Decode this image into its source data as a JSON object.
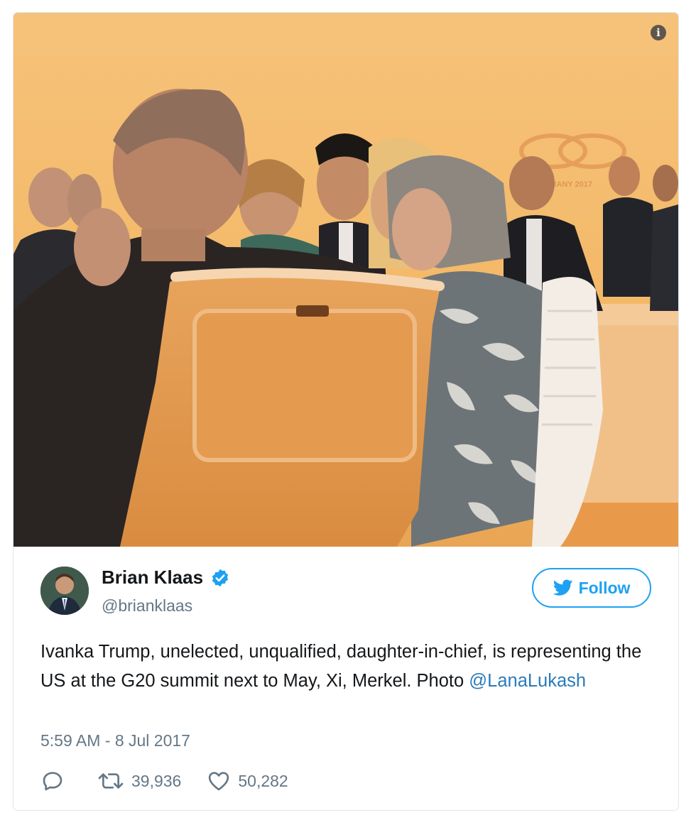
{
  "tweet": {
    "author_name": "Brian Klaas",
    "handle": "@brianklaas",
    "follow_label": "Follow",
    "text_before_mention": "Ivanka Trump, unelected, unqualified, daughter-in-chief, is representing the US at the G20 summit next to May, Xi, Merkel. Photo ",
    "mention": "@LanaLukash",
    "timestamp": "5:59 AM - 8 Jul 2017",
    "retweets": "39,936",
    "likes": "50,282"
  },
  "photo": {
    "backdrop_text": "ERMANY 2017"
  },
  "colors": {
    "accent": "#1da1f2",
    "text": "#14171a",
    "muted": "#657786",
    "link": "#2b7bb9"
  },
  "icons": {
    "info": "info-icon",
    "verified": "verified-badge-icon",
    "bird": "twitter-bird-icon",
    "reply": "reply-icon",
    "retweet": "retweet-icon",
    "like": "heart-icon"
  }
}
